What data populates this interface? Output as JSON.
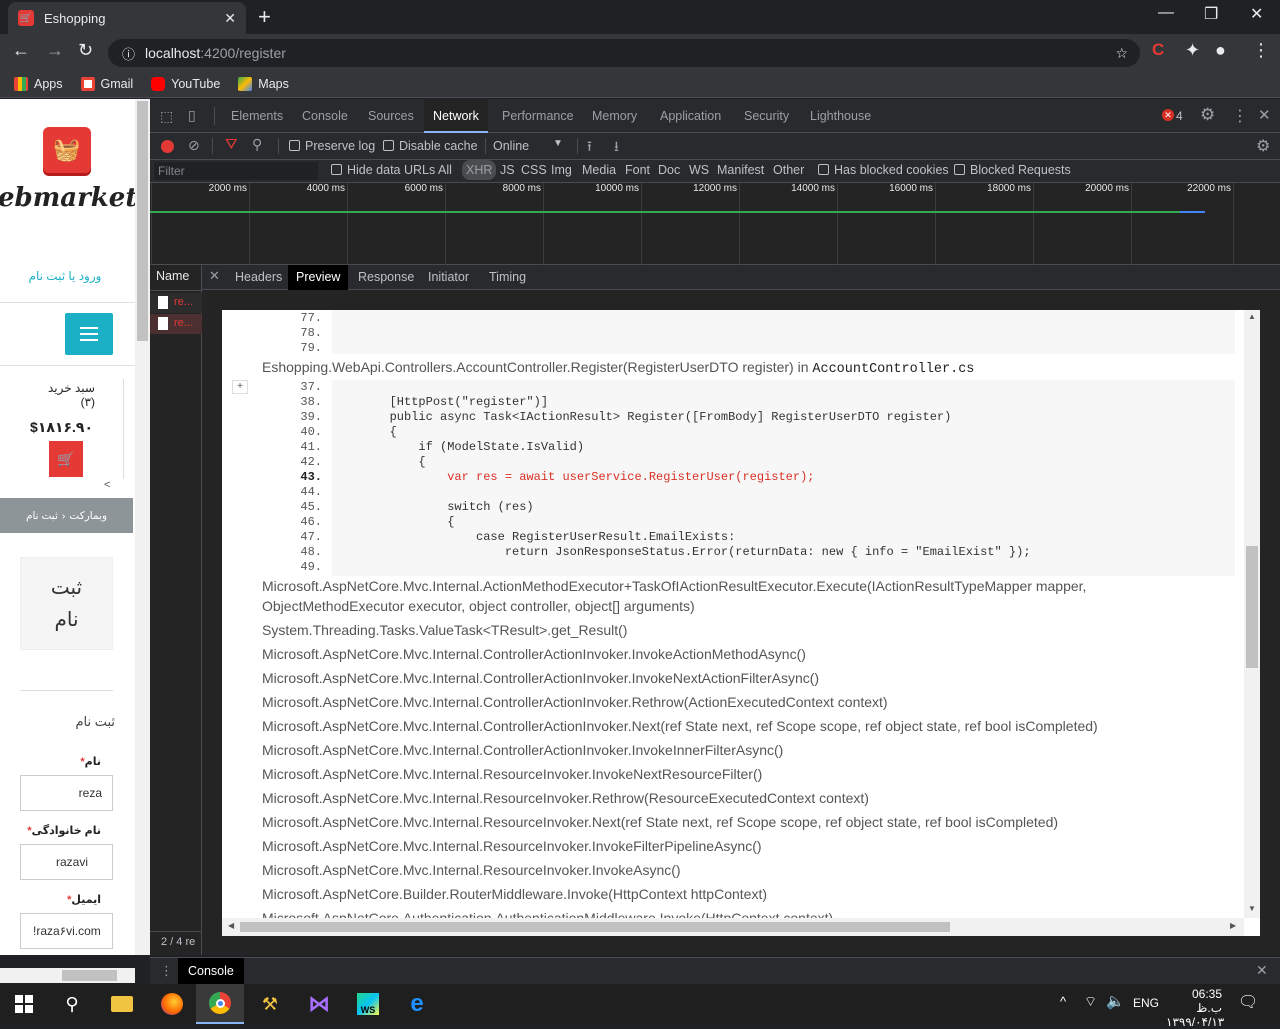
{
  "browser": {
    "tab_title": "Eshopping",
    "url_host": "localhost",
    "url_path": ":4200/register",
    "bookmarks": [
      "Apps",
      "Gmail",
      "YouTube",
      "Maps"
    ]
  },
  "page": {
    "brand": "ebmarket",
    "auth_link": "ورود یا ثبت نام",
    "cart_label": "سبد خرید",
    "cart_count": "(۳)",
    "cart_total": "$۱۸۱۶.۹۰",
    "breadcrumb_home": "وبمارکت",
    "breadcrumb_current": "ثبت نام",
    "card_title": "ثبت نام",
    "form_title": "ثبت نام",
    "first_name_label": "نام",
    "first_name_value": "reza",
    "last_name_label": "نام خانوادگی",
    "last_name_value": "razavi",
    "email_label": "ایمیل",
    "email_value": "!raza۶vi.com"
  },
  "devtools": {
    "tabs": [
      "Elements",
      "Console",
      "Sources",
      "Network",
      "Performance",
      "Memory",
      "Application",
      "Security",
      "Lighthouse"
    ],
    "active_tab": "Network",
    "error_count": "4",
    "preserve_log": "Preserve log",
    "disable_cache": "Disable cache",
    "throttle": "Online",
    "filter_placeholder": "Filter",
    "hide_data_urls": "Hide data URLs",
    "types": [
      "All",
      "XHR",
      "JS",
      "CSS",
      "Img",
      "Media",
      "Font",
      "Doc",
      "WS",
      "Manifest",
      "Other"
    ],
    "has_blocked_cookies": "Has blocked cookies",
    "blocked_requests": "Blocked Requests",
    "timeline_ticks": [
      "2000 ms",
      "4000 ms",
      "6000 ms",
      "8000 ms",
      "10000 ms",
      "12000 ms",
      "14000 ms",
      "16000 ms",
      "18000 ms",
      "20000 ms",
      "22000 ms"
    ],
    "name_header": "Name",
    "request_names": [
      "re...",
      "re..."
    ],
    "request_count": "2 / 4 re",
    "sub_tabs": [
      "Headers",
      "Preview",
      "Response",
      "Initiator",
      "Timing"
    ],
    "active_sub_tab": "Preview",
    "console_label": "Console"
  },
  "preview": {
    "top_lines": [
      {
        "n": "77.",
        "t": ""
      },
      {
        "n": "78.",
        "t": ""
      },
      {
        "n": "79.",
        "t": ""
      }
    ],
    "frame_text": "Eshopping.WebApi.Controllers.AccountController.Register(RegisterUserDTO register) in ",
    "frame_file": "AccountController.cs",
    "code_lines": [
      {
        "n": "37.",
        "t": ""
      },
      {
        "n": "38.",
        "t": "        [HttpPost(\"register\")]"
      },
      {
        "n": "39.",
        "t": "        public async Task<IActionResult> Register([FromBody] RegisterUserDTO register)"
      },
      {
        "n": "40.",
        "t": "        {"
      },
      {
        "n": "41.",
        "t": "            if (ModelState.IsValid)"
      },
      {
        "n": "42.",
        "t": "            {"
      },
      {
        "n": "43.",
        "t": "                var res = await userService.RegisterUser(register);"
      },
      {
        "n": "44.",
        "t": ""
      },
      {
        "n": "45.",
        "t": "                switch (res)"
      },
      {
        "n": "46.",
        "t": "                {"
      },
      {
        "n": "47.",
        "t": "                    case RegisterUserResult.EmailExists:"
      },
      {
        "n": "48.",
        "t": "                        return JsonResponseStatus.Error(returnData: new { info = \"EmailExist\" });"
      },
      {
        "n": "49.",
        "t": ""
      }
    ],
    "stack": [
      "Microsoft.AspNetCore.Mvc.Internal.ActionMethodExecutor+TaskOfIActionResultExecutor.Execute(IActionResultTypeMapper mapper,",
      "ObjectMethodExecutor executor, object controller, object[] arguments)",
      "System.Threading.Tasks.ValueTask<TResult>.get_Result()",
      "Microsoft.AspNetCore.Mvc.Internal.ControllerActionInvoker.InvokeActionMethodAsync()",
      "Microsoft.AspNetCore.Mvc.Internal.ControllerActionInvoker.InvokeNextActionFilterAsync()",
      "Microsoft.AspNetCore.Mvc.Internal.ControllerActionInvoker.Rethrow(ActionExecutedContext context)",
      "Microsoft.AspNetCore.Mvc.Internal.ControllerActionInvoker.Next(ref State next, ref Scope scope, ref object state, ref bool isCompleted)",
      "Microsoft.AspNetCore.Mvc.Internal.ControllerActionInvoker.InvokeInnerFilterAsync()",
      "Microsoft.AspNetCore.Mvc.Internal.ResourceInvoker.InvokeNextResourceFilter()",
      "Microsoft.AspNetCore.Mvc.Internal.ResourceInvoker.Rethrow(ResourceExecutedContext context)",
      "Microsoft.AspNetCore.Mvc.Internal.ResourceInvoker.Next(ref State next, ref Scope scope, ref object state, ref bool isCompleted)",
      "Microsoft.AspNetCore.Mvc.Internal.ResourceInvoker.InvokeFilterPipelineAsync()",
      "Microsoft.AspNetCore.Mvc.Internal.ResourceInvoker.InvokeAsync()",
      "Microsoft.AspNetCore.Builder.RouterMiddleware.Invoke(HttpContext httpContext)",
      "Microsoft.AspNetCore.Authentication.AuthenticationMiddleware.Invoke(HttpContext context)"
    ]
  },
  "taskbar": {
    "lang": "ENG",
    "time": "06:35 ب.ظ",
    "date": "۱۳۹۹/۰۴/۱۳"
  },
  "colors": {
    "accent_teal": "#1bb0c6",
    "brand_red": "#e53935",
    "error_red": "#d93025"
  }
}
